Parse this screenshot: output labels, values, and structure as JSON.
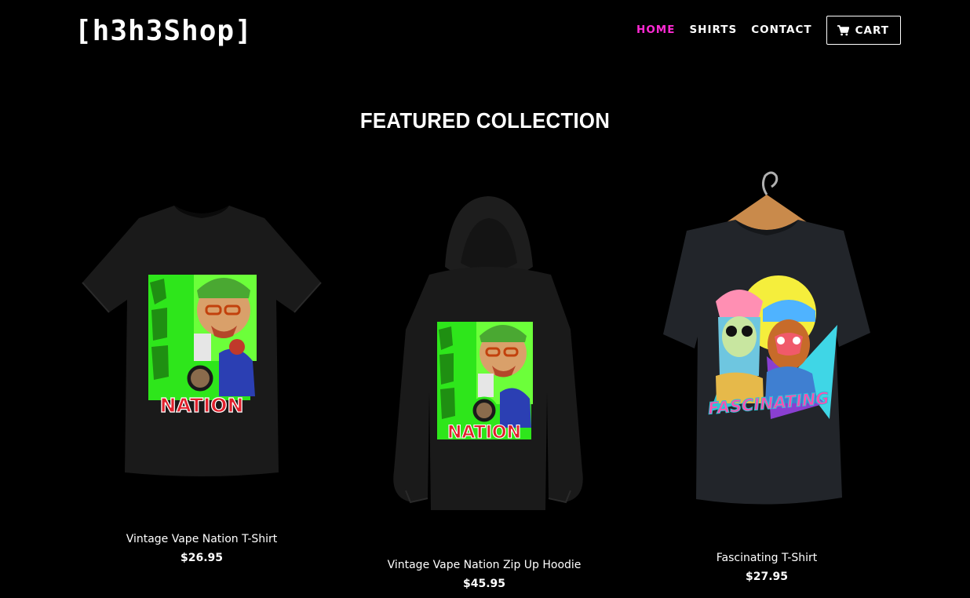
{
  "header": {
    "logo": "[h3h3Shop]",
    "nav": [
      {
        "label": "HOME",
        "active": true
      },
      {
        "label": "SHIRTS",
        "active": false
      },
      {
        "label": "CONTACT",
        "active": false
      }
    ],
    "cart_label": "CART",
    "cart_icon": "shopping-cart-icon"
  },
  "featured": {
    "title": "FEATURED COLLECTION",
    "products": [
      {
        "name": "Vintage Vape Nation T-Shirt",
        "price": "$26.95",
        "print_text": "NATION"
      },
      {
        "name": "Vintage Vape Nation Zip Up Hoodie",
        "price": "$45.95",
        "print_text": "NATION"
      },
      {
        "name": "Fascinating T-Shirt",
        "price": "$27.95",
        "print_text": "FASCINATING"
      }
    ]
  },
  "colors": {
    "background": "#000000",
    "text": "#ffffff",
    "accent": "#ff2ad4",
    "vape_green": "#2ee61b",
    "nation_red": "#e0202c"
  }
}
